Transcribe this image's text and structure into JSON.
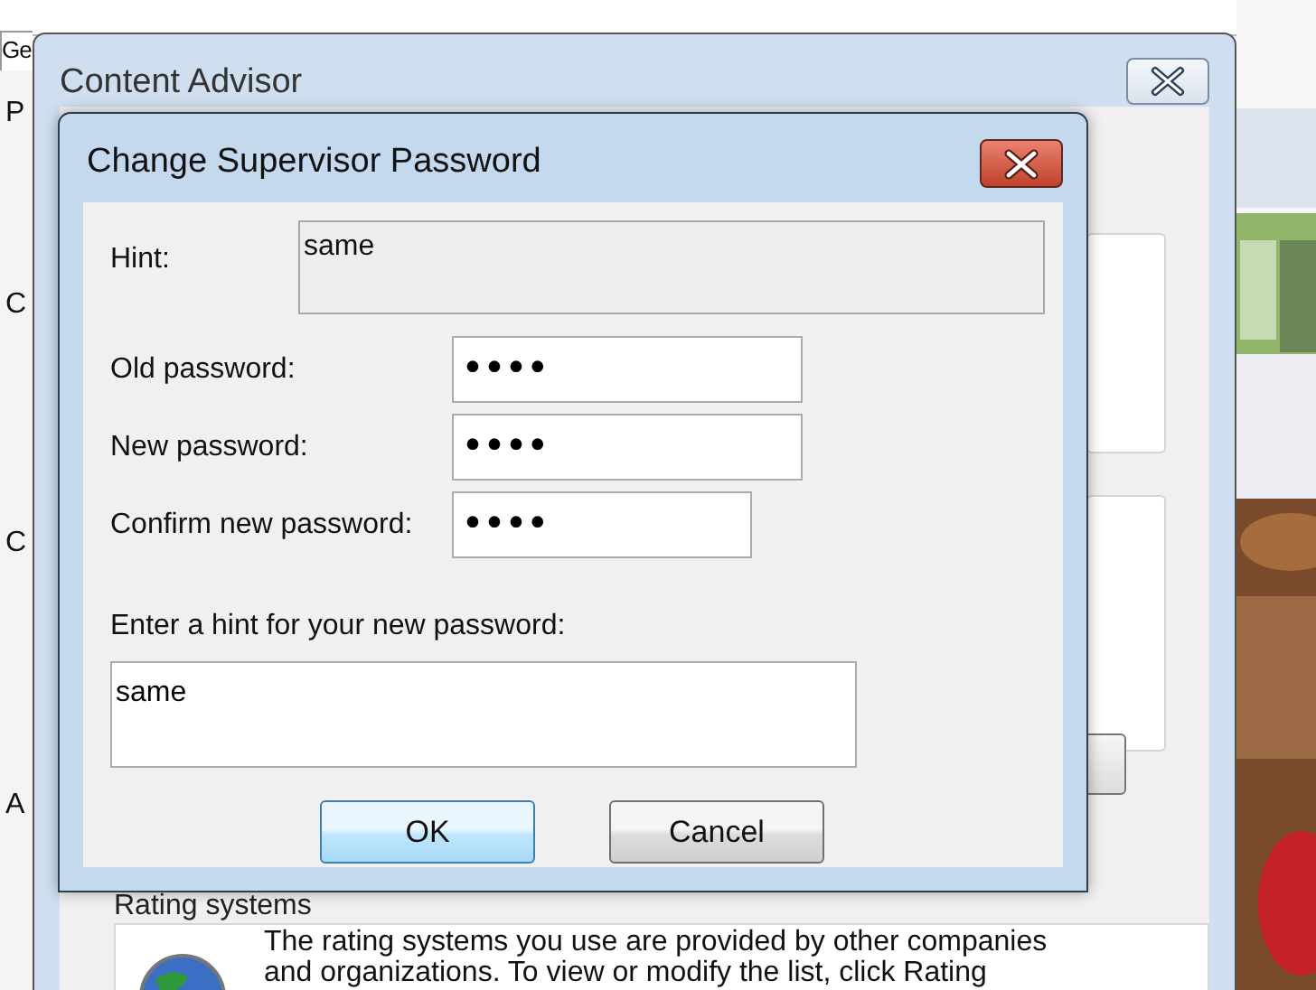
{
  "background_window": {
    "tab": "Ge",
    "side_letters": [
      "P",
      "C",
      "C",
      "A"
    ]
  },
  "content_advisor": {
    "title": "Content Advisor",
    "rating_systems": {
      "heading": "Rating systems",
      "text": "The rating systems you use are provided by other companies and organizations. To view or modify the list, click Rating"
    }
  },
  "dialog": {
    "title": "Change Supervisor Password",
    "hint": {
      "label": "Hint:",
      "value": "same"
    },
    "fields": [
      {
        "label": "Old password:",
        "value": "••••"
      },
      {
        "label": "New password:",
        "value": "••••"
      },
      {
        "label": "Confirm new password:",
        "value": "••••"
      }
    ],
    "new_hint": {
      "label": "Enter a hint for your new password:",
      "value": "same"
    },
    "buttons": [
      {
        "label": "OK",
        "default": true
      },
      {
        "label": "Cancel",
        "default": false
      }
    ]
  }
}
